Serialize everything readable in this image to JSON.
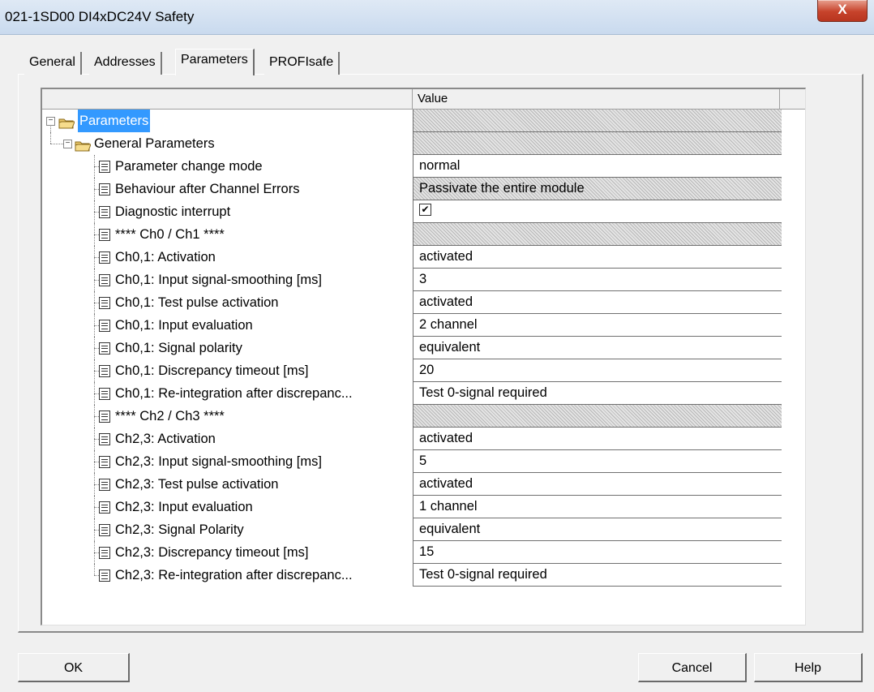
{
  "window": {
    "title": "021-1SD00 DI4xDC24V Safety",
    "close_label": "X"
  },
  "tabs": [
    {
      "label": "General"
    },
    {
      "label": "Addresses"
    },
    {
      "label": "Parameters"
    },
    {
      "label": "PROFIsafe"
    }
  ],
  "grid": {
    "header_value": "Value"
  },
  "rows": [
    {
      "label": "Parameters",
      "value": ""
    },
    {
      "label": "General Parameters",
      "value": ""
    },
    {
      "label": "Parameter change mode",
      "value": "normal"
    },
    {
      "label": "Behaviour after Channel Errors",
      "value": "Passivate the entire module"
    },
    {
      "label": "Diagnostic interrupt",
      "value": "✔"
    },
    {
      "label": "**** Ch0 / Ch1 ****",
      "value": ""
    },
    {
      "label": "Ch0,1: Activation",
      "value": "activated"
    },
    {
      "label": "Ch0,1: Input signal-smoothing [ms]",
      "value": "3"
    },
    {
      "label": "Ch0,1: Test pulse activation",
      "value": "activated"
    },
    {
      "label": "Ch0,1: Input evaluation",
      "value": "2 channel"
    },
    {
      "label": "Ch0,1: Signal polarity",
      "value": "equivalent"
    },
    {
      "label": "Ch0,1: Discrepancy timeout [ms]",
      "value": "20"
    },
    {
      "label": "Ch0,1: Re-integration after discrepanc...",
      "value": "Test 0-signal required"
    },
    {
      "label": "**** Ch2 / Ch3 ****",
      "value": ""
    },
    {
      "label": "Ch2,3: Activation",
      "value": "activated"
    },
    {
      "label": "Ch2,3: Input signal-smoothing [ms]",
      "value": "5"
    },
    {
      "label": "Ch2,3: Test pulse activation",
      "value": "activated"
    },
    {
      "label": "Ch2,3: Input evaluation",
      "value": "1 channel"
    },
    {
      "label": "Ch2,3: Signal Polarity",
      "value": "equivalent"
    },
    {
      "label": "Ch2,3: Discrepancy timeout [ms]",
      "value": "15"
    },
    {
      "label": "Ch2,3: Re-integration after discrepanc...",
      "value": "Test 0-signal required"
    }
  ],
  "buttons": {
    "ok": "OK",
    "cancel": "Cancel",
    "help": "Help"
  }
}
